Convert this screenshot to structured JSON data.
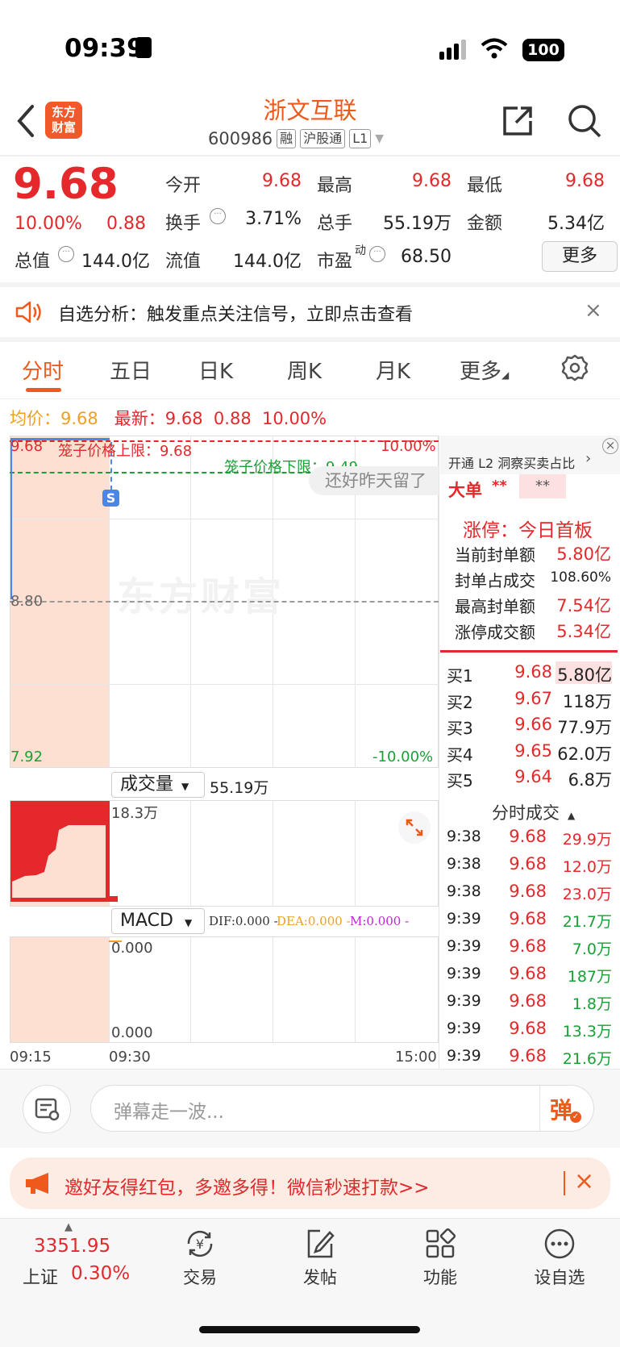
{
  "status": {
    "time": "09:39",
    "battery": "100"
  },
  "header": {
    "logo_line1": "东方",
    "logo_line2": "财富",
    "name": "浙文互联",
    "code": "600986",
    "tags": [
      "融",
      "沪股通",
      "L1"
    ]
  },
  "quote": {
    "price": "9.68",
    "pct": "10.00%",
    "change": "0.88",
    "open_label": "今开",
    "open": "9.68",
    "high_label": "最高",
    "high": "9.68",
    "low_label": "最低",
    "low": "9.68",
    "turnover_label": "换手",
    "turnover": "3.71%",
    "volume_label": "总手",
    "volume": "55.19万",
    "amount_label": "金额",
    "amount": "5.34亿",
    "mktcap_label": "总值",
    "mktcap": "144.0亿",
    "float_label": "流值",
    "float": "144.0亿",
    "pe_label": "市盈",
    "pe_sup": "动",
    "pe": "68.50",
    "more": "更多"
  },
  "analysis": {
    "text": "自选分析：触发重点关注信号，立即点击查看"
  },
  "tabs": [
    "分时",
    "五日",
    "日K",
    "周K",
    "月K",
    "更多"
  ],
  "avgline": {
    "avg_label": "均价：",
    "avg": "9.68",
    "last_label": "最新：",
    "last": "9.68",
    "chg": "0.88",
    "pct": "10.00%"
  },
  "chart": {
    "top_price": "9.68",
    "top_pct": "10.00%",
    "upper_limit": "笼子价格上限：9.68",
    "lower_limit": "笼子价格下限：9.49",
    "mid": "8.80",
    "bottom_price": "7.92",
    "bottom_pct": "-10.00%",
    "danmu_bubble": "还好昨天留了",
    "watermark": "东方财富",
    "s_marker": "S",
    "volume_selector": "成交量",
    "volume_total": "55.19万",
    "vol_max": "18.3万",
    "macd_selector": "MACD",
    "dif": "DIF:0.000 -",
    "dea": "DEA:0.000 -",
    "m": "M:0.000 -",
    "macd_top": "0.000",
    "macd_bottom": "0.000",
    "times": [
      "09:15",
      "09:30",
      "15:00"
    ],
    "colors": {
      "up": "#e5282b",
      "fill": "#fde0d2",
      "limit_green": "#1aa034"
    }
  },
  "right_panel": {
    "l2_text": "开通 L2 洞察买卖占比",
    "big_order": "大单",
    "big_a": "**",
    "big_b": "**",
    "limit_title": "涨停：今日首板",
    "stats": [
      {
        "label": "当前封单额",
        "value": "5.80亿"
      },
      {
        "label": "封单占成交",
        "value": "108.60%"
      },
      {
        "label": "最高封单额",
        "value": "7.54亿"
      },
      {
        "label": "涨停成交额",
        "value": "5.34亿"
      }
    ],
    "orderbook": [
      {
        "label": "买1",
        "price": "9.68",
        "vol": "5.80亿"
      },
      {
        "label": "买2",
        "price": "9.67",
        "vol": "118万"
      },
      {
        "label": "买3",
        "price": "9.66",
        "vol": "77.9万"
      },
      {
        "label": "买4",
        "price": "9.65",
        "vol": "62.0万"
      },
      {
        "label": "买5",
        "price": "9.64",
        "vol": "6.8万"
      }
    ],
    "ticks_title": "分时成交",
    "ticks": [
      {
        "time": "9:38",
        "price": "9.68",
        "vol": "29.9万"
      },
      {
        "time": "9:38",
        "price": "9.68",
        "vol": "12.0万"
      },
      {
        "time": "9:38",
        "price": "9.68",
        "vol": "23.0万"
      },
      {
        "time": "9:39",
        "price": "9.68",
        "vol": "21.7万"
      },
      {
        "time": "9:39",
        "price": "9.68",
        "vol": "7.0万"
      },
      {
        "time": "9:39",
        "price": "9.68",
        "vol": "187万"
      },
      {
        "time": "9:39",
        "price": "9.68",
        "vol": "1.8万"
      },
      {
        "time": "9:39",
        "price": "9.68",
        "vol": "13.3万"
      },
      {
        "time": "9:39",
        "price": "9.68",
        "vol": "21.6万"
      }
    ]
  },
  "danmu": {
    "placeholder": "弹幕走一波...",
    "send": "弹"
  },
  "invite": {
    "text": "邀好友得红包，多邀多得！微信秒速打款>>"
  },
  "bottom_nav": {
    "index_value": "3351.95",
    "index_name": "上证",
    "index_pct": "0.30%",
    "items": [
      "交易",
      "发帖",
      "功能",
      "设自选"
    ]
  }
}
